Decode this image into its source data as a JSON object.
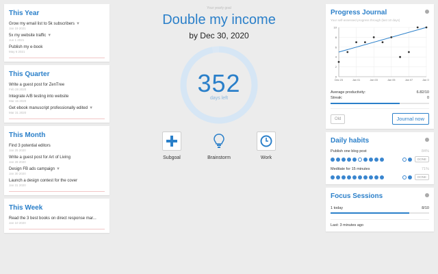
{
  "left": {
    "sections": [
      {
        "title": "This Year",
        "goals": [
          {
            "text": "Grow my email list to 5k subscribers",
            "date": "Jan 19 2021"
          },
          {
            "text": "5x my website traffic",
            "date": "Jun 1 2021"
          },
          {
            "text": "Publish my e-book",
            "date": "May 6 2021"
          }
        ]
      },
      {
        "title": "This Quarter",
        "goals": [
          {
            "text": "Write a guest post for ZenTree",
            "date": "Feb 28 2020"
          },
          {
            "text": "Integrate A/B testing into website",
            "date": "Mar 15 2020"
          },
          {
            "text": "Get ebook manuscript professionally edited",
            "date": "Mar 31 2020"
          }
        ]
      },
      {
        "title": "This Month",
        "goals": [
          {
            "text": "Find 3 potential editors",
            "date": "Jan 25 2020"
          },
          {
            "text": "Write a guest post for Art of Living",
            "date": "Jan 28 2020"
          },
          {
            "text": "Design FB ads campaign",
            "date": "Jan 30 2020"
          },
          {
            "text": "Launch a design contest for the cover",
            "date": "Jan 31 2020"
          }
        ]
      },
      {
        "title": "This Week",
        "goals": [
          {
            "text": "Read the 3 best books on direct response mar...",
            "date": "Jan 10 2020"
          }
        ]
      }
    ]
  },
  "center": {
    "your_goal_label": "Your yearly goal",
    "title": "Double my income",
    "by_date": "by Dec 30, 2020",
    "days": "352",
    "days_label": "days left",
    "progress_fraction": 0.97,
    "actions": [
      {
        "label": "Subgoal",
        "icon": "plus-icon"
      },
      {
        "label": "Brainstorm",
        "icon": "lightbulb-icon"
      },
      {
        "label": "Work",
        "icon": "clock-icon"
      }
    ]
  },
  "journal": {
    "title": "Progress Journal",
    "subtitle": "Your self-assessed progress through (last 10 days)",
    "avg_label": "Average productivity:",
    "avg_value": "6.82/10",
    "streak_label": "Streak:",
    "streak_value": "0",
    "streak_fraction": 0.7,
    "old_label": "Old",
    "journal_label": "Journal now"
  },
  "chart_data": {
    "type": "scatter",
    "x": [
      "Dec 23",
      "Dec 26",
      "Dec 30",
      "Jan 2",
      "Jan 5",
      "Jan 8",
      "Jan 12",
      "Jan 15",
      "Jan 18",
      "Jan 21",
      "Jan 24"
    ],
    "values": [
      3,
      5,
      7,
      7,
      8,
      7,
      8,
      4,
      5,
      10,
      10
    ],
    "trend": [
      5,
      10
    ],
    "x_ticks": [
      "Dec 23",
      "Jan 01",
      "Jan 03",
      "Jan 05",
      "Jan 07",
      "Jan 09"
    ],
    "y_ticks": [
      "0",
      "2",
      "4",
      "6",
      "8",
      "10"
    ],
    "ylim": [
      0,
      10
    ],
    "grid": true
  },
  "habits": {
    "title": "Daily habits",
    "items": [
      {
        "name": "Publish one blog post",
        "pct": "84%",
        "dots": [
          1,
          1,
          1,
          1,
          1,
          0,
          1,
          1,
          1,
          1,
          0,
          1
        ],
        "done": "DONE"
      },
      {
        "name": "Meditate for 15 minutes",
        "pct": "71%",
        "dots": [
          1,
          1,
          1,
          1,
          1,
          1,
          1,
          1,
          1,
          1,
          0,
          1
        ],
        "done": "DONE"
      }
    ]
  },
  "focus": {
    "title": "Focus Sessions",
    "today_label": "1 today",
    "count": "8/10",
    "fraction": 0.8,
    "last_label": "Last: 3 minutes ago"
  },
  "colors": {
    "accent": "#2a7fc9",
    "ring": "#dbe8f5"
  }
}
